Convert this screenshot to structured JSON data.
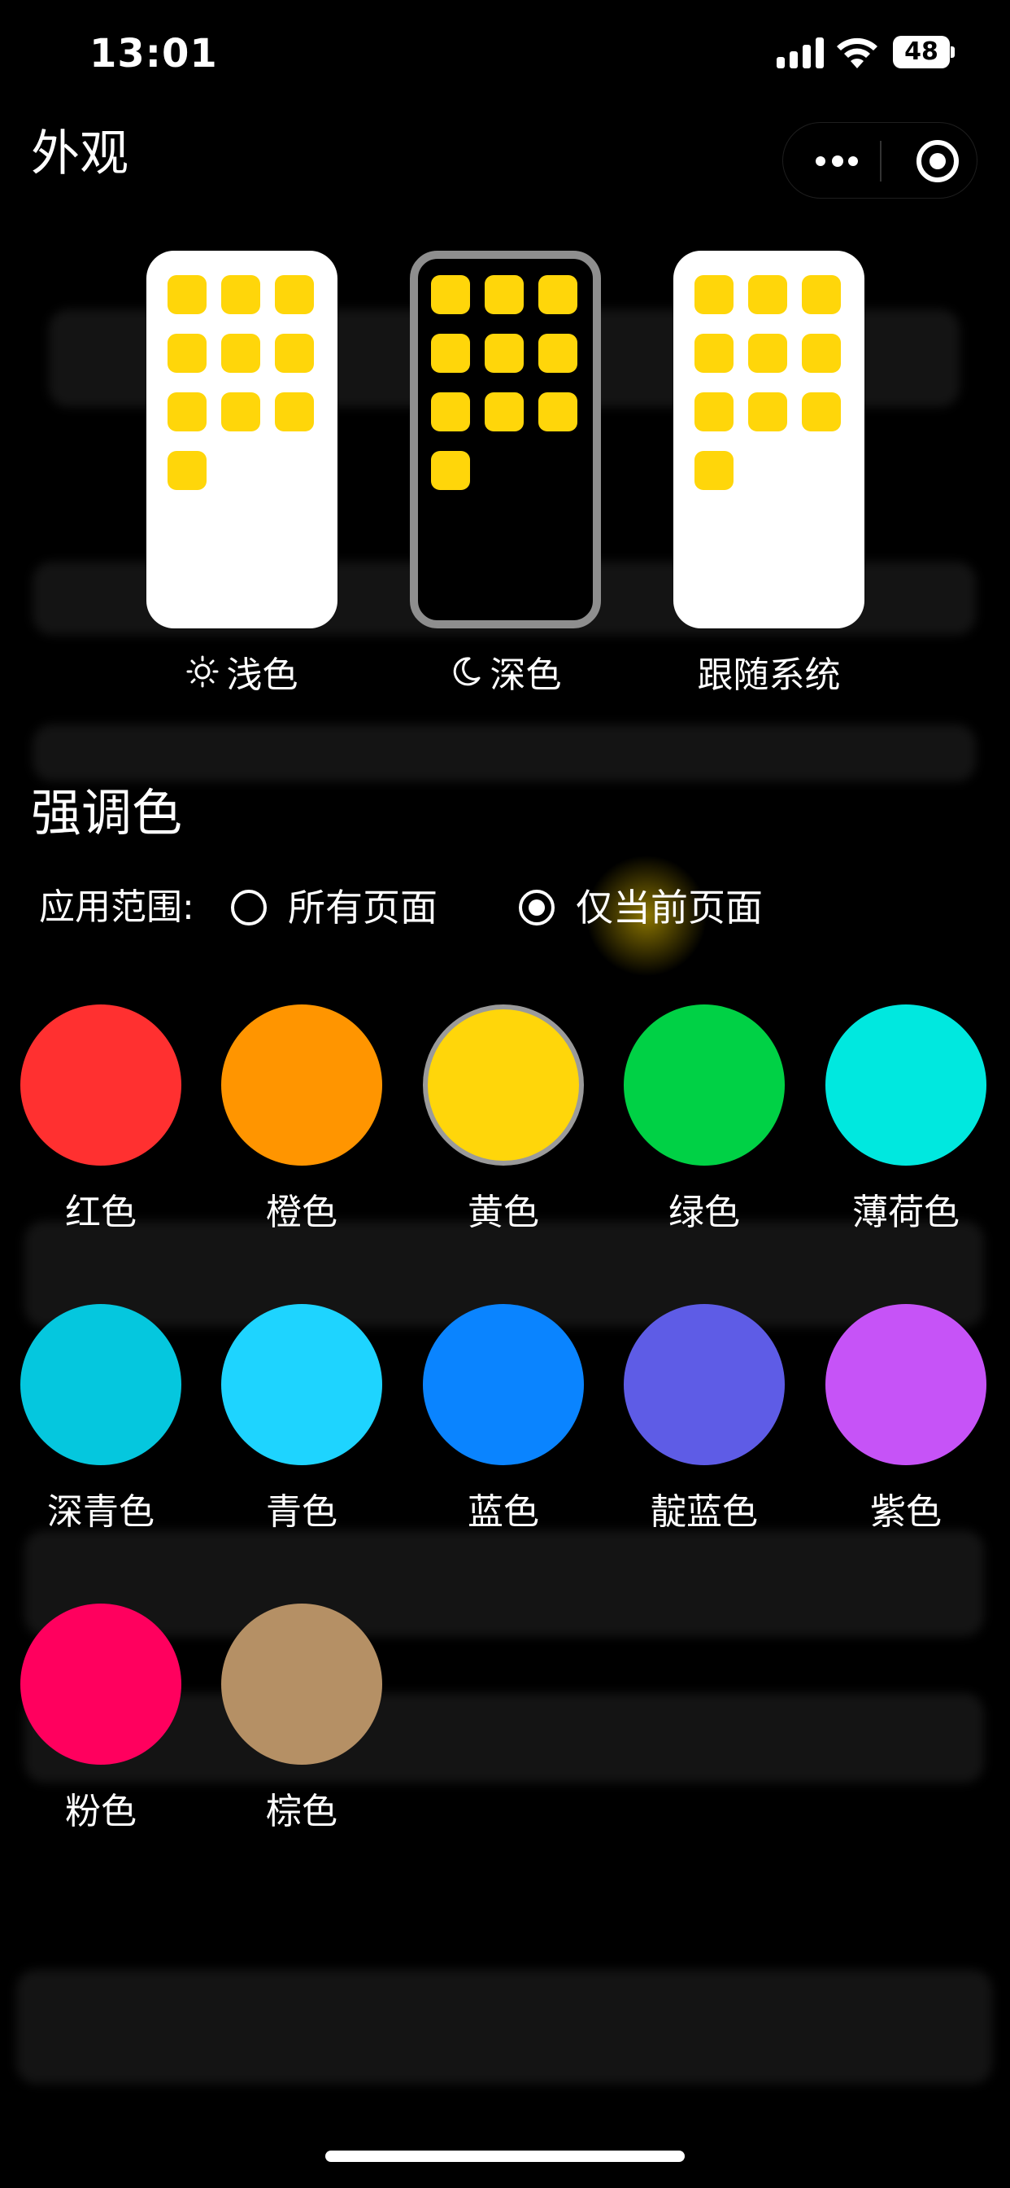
{
  "status_bar": {
    "time": "13:01",
    "battery": "48",
    "icons": [
      "signal-icon",
      "wifi-icon",
      "battery-icon"
    ]
  },
  "header": {
    "title": "外观",
    "capsule_icons": [
      "more-icon",
      "target-icon"
    ]
  },
  "appearance": {
    "modes": [
      {
        "label": "浅色",
        "icon": "sun-icon",
        "style": "light",
        "selected": false
      },
      {
        "label": "深色",
        "icon": "moon-icon",
        "style": "dark",
        "selected": true
      },
      {
        "label": "跟随系统",
        "icon": "",
        "style": "light",
        "selected": false
      }
    ],
    "app_icon_color": "#FFD60A"
  },
  "accent": {
    "title": "强调色",
    "scope_label": "应用范围:",
    "scope_options": [
      {
        "label": "所有页面",
        "checked": false
      },
      {
        "label": "仅当前页面",
        "checked": true
      }
    ],
    "colors": [
      {
        "label": "红色",
        "hex": "#FF3030",
        "selected": false
      },
      {
        "label": "橙色",
        "hex": "#FF9500",
        "selected": false
      },
      {
        "label": "黄色",
        "hex": "#FFD60A",
        "selected": true
      },
      {
        "label": "绿色",
        "hex": "#00D145",
        "selected": false
      },
      {
        "label": "薄荷色",
        "hex": "#00E8DF",
        "selected": false
      },
      {
        "label": "深青色",
        "hex": "#05C7DE",
        "selected": false
      },
      {
        "label": "青色",
        "hex": "#1ED4FF",
        "selected": false
      },
      {
        "label": "蓝色",
        "hex": "#0A84FF",
        "selected": false
      },
      {
        "label": "靛蓝色",
        "hex": "#5E5CE6",
        "selected": false
      },
      {
        "label": "紫色",
        "hex": "#C653F7",
        "selected": false
      },
      {
        "label": "粉色",
        "hex": "#FF005E",
        "selected": false
      },
      {
        "label": "棕色",
        "hex": "#B59065",
        "selected": false
      }
    ]
  }
}
